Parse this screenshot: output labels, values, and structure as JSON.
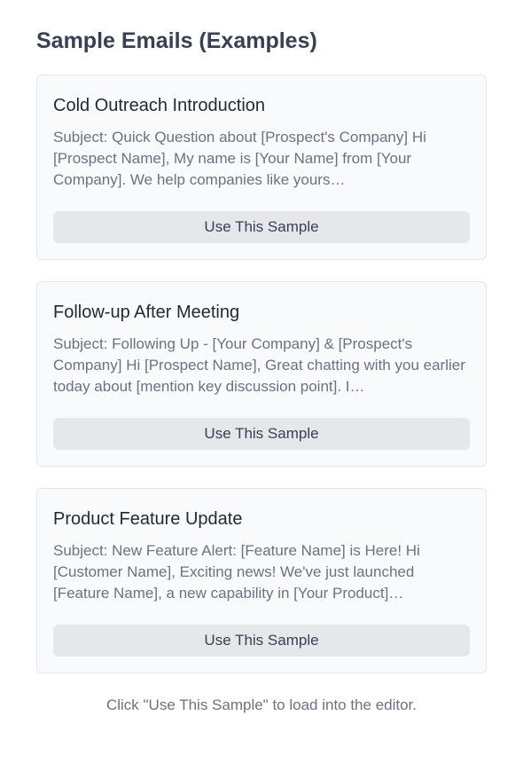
{
  "title": "Sample Emails (Examples)",
  "samples": [
    {
      "name": "Cold Outreach Introduction",
      "preview": "Subject: Quick Question about [Prospect's Company] Hi [Prospect Name], My name is [Your Name] from [Your Company]. We help companies like yours…",
      "button": "Use This Sample"
    },
    {
      "name": "Follow-up After Meeting",
      "preview": "Subject: Following Up - [Your Company] & [Prospect's Company] Hi [Prospect Name], Great chatting with you earlier today about [mention key discussion point]. I…",
      "button": "Use This Sample"
    },
    {
      "name": "Product Feature Update",
      "preview": "Subject: New Feature Alert: [Feature Name] is Here! Hi [Customer Name], Exciting news! We've just launched [Feature Name], a new capability in [Your Product]…",
      "button": "Use This Sample"
    }
  ],
  "footer": "Click \"Use This Sample\" to load into the editor.",
  "colors": {
    "card_background": "#f9fafb",
    "card_border": "#e5e7eb",
    "button_background": "#e5e7eb",
    "heading_text": "#374151",
    "muted_text": "#6b7280"
  }
}
